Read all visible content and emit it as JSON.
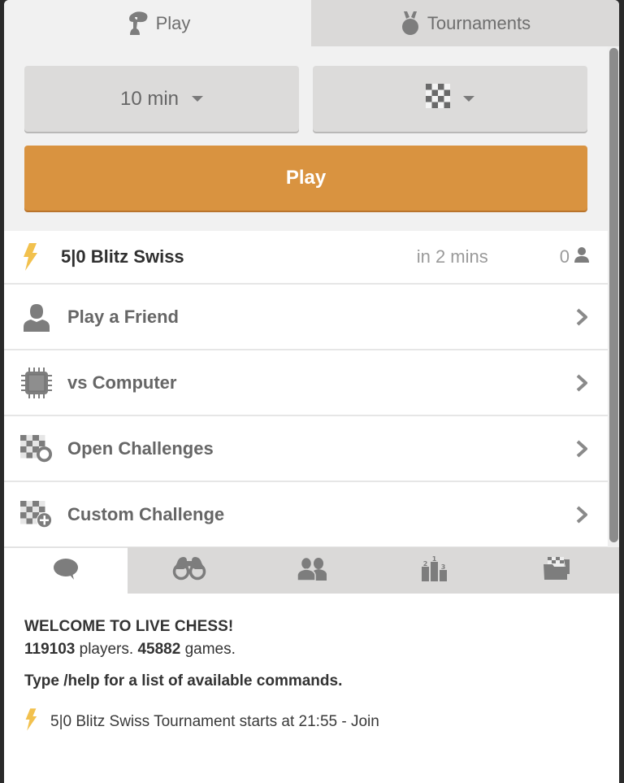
{
  "top_tabs": [
    {
      "label": "Play",
      "icon": "pawn-play-icon",
      "active": true
    },
    {
      "label": "Tournaments",
      "icon": "medal-icon",
      "active": false
    }
  ],
  "play_panel": {
    "time_control": "10 min",
    "variant_icon": "chessboard-icon",
    "play_button": "Play"
  },
  "tournament_row": {
    "icon": "lightning-bolt-icon",
    "name": "5|0 Blitz Swiss",
    "starts": "in 2 mins",
    "player_count": "0"
  },
  "menu_items": [
    {
      "label": "Play a Friend",
      "icon": "person-icon"
    },
    {
      "label": "vs Computer",
      "icon": "cpu-chip-icon"
    },
    {
      "label": "Open Challenges",
      "icon": "board-circle-icon"
    },
    {
      "label": "Custom Challenge",
      "icon": "board-plus-icon"
    }
  ],
  "bottom_tabs": [
    {
      "name": "chat",
      "icon": "chat-bubble-icon",
      "active": true
    },
    {
      "name": "watch",
      "icon": "binoculars-icon",
      "active": false
    },
    {
      "name": "players",
      "icon": "people-icon",
      "active": false
    },
    {
      "name": "leaderboard",
      "icon": "podium-icon",
      "active": false
    },
    {
      "name": "archive",
      "icon": "folder-board-icon",
      "active": false
    }
  ],
  "chat": {
    "welcome": "WELCOME TO LIVE CHESS!",
    "players_count": "119103",
    "players_label": " players. ",
    "games_count": "45882",
    "games_label": " games.",
    "help": "Type /help for a list of available commands.",
    "notice": "5|0 Blitz Swiss Tournament starts at 21:55 - Join"
  },
  "colors": {
    "accent_orange": "#d99340",
    "bolt_yellow": "#f2c14e",
    "icon_gray": "#7d7d7d"
  }
}
